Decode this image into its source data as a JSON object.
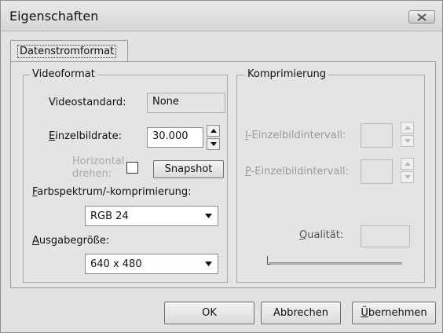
{
  "window": {
    "title": "Eigenschaften"
  },
  "tabs": [
    {
      "label": "Datenstromformat"
    }
  ],
  "video": {
    "group_label": "Videoformat",
    "standard_label": "Videostandard:",
    "standard_value": "None",
    "framerate_label_ul": "E",
    "framerate_label_rest": "inzelbildrate:",
    "framerate_value": "30.000",
    "flip_label_line1": "Horizontal",
    "flip_label_line2": "drehen:",
    "snapshot_button": "Snapshot",
    "colorspace_label_ul": "F",
    "colorspace_label_rest": "arbspektrum/-komprimierung:",
    "colorspace_value": "RGB 24",
    "outsize_label_ul": "A",
    "outsize_label_rest": "usgabegröße:",
    "outsize_value": "640 x 480"
  },
  "compression": {
    "group_label": "Komprimierung",
    "i_label_ul": "I",
    "i_label_rest": "-Einzelbildintervall:",
    "p_label_ul": "P",
    "p_label_rest": "-Einzelbildintervall:",
    "quality_label_ul": "Q",
    "quality_label_rest": "ualität:"
  },
  "buttons": {
    "ok": "OK",
    "cancel": "Abbrechen",
    "apply_ul": "Ü",
    "apply_rest": "bernehmen"
  }
}
